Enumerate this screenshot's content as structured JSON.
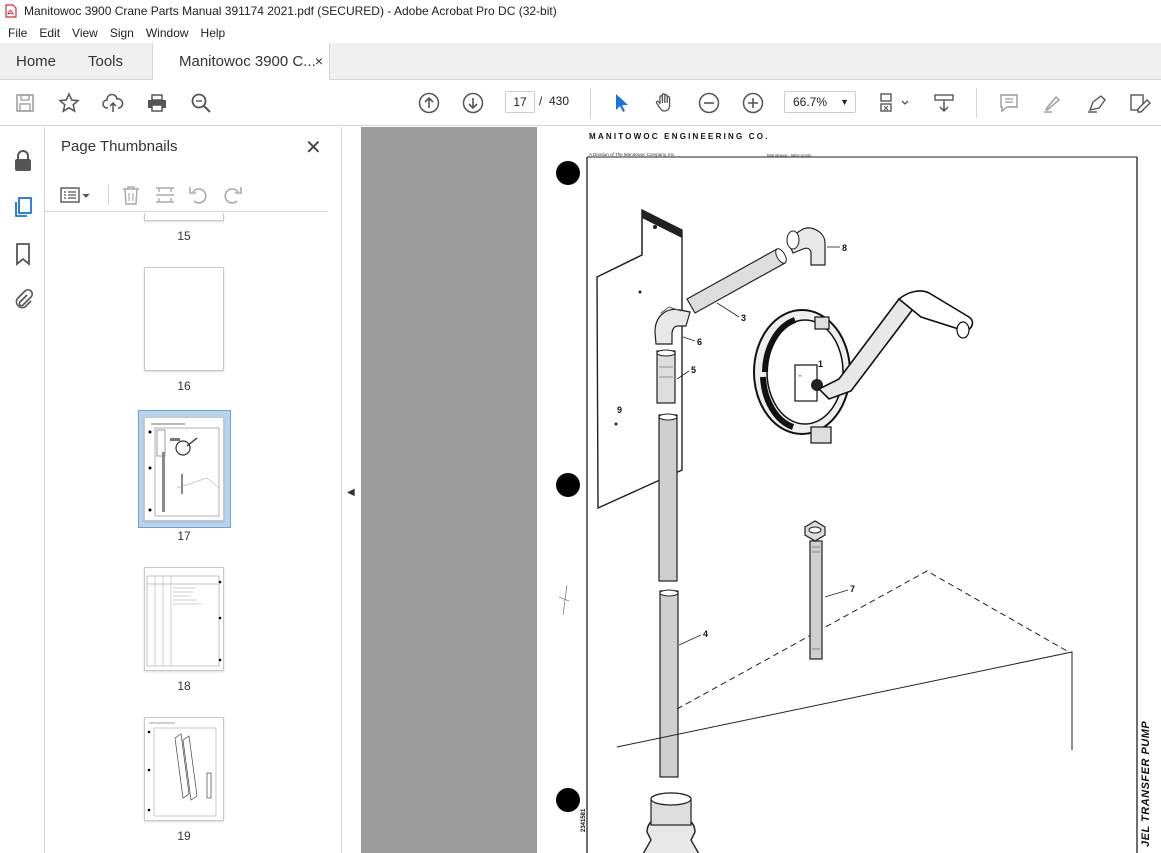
{
  "window": {
    "title": "Manitowoc 3900 Crane Parts Manual 391174 2021.pdf (SECURED) - Adobe Acrobat Pro DC (32-bit)"
  },
  "menu": [
    "File",
    "Edit",
    "View",
    "Sign",
    "Window",
    "Help"
  ],
  "tabs": {
    "home": "Home",
    "tools": "Tools",
    "doc": "Manitowoc 3900 C...",
    "doc_close": "×"
  },
  "toolbar": {
    "current_page": "17",
    "page_separator": "/",
    "total_pages": "430",
    "zoom": "66.7%",
    "icons": [
      "save-icon",
      "bookmark-star-icon",
      "upload-icon",
      "print-icon",
      "find-icon",
      "prev-page-icon",
      "next-page-icon",
      "select-cursor-icon",
      "hand-icon",
      "zoom-out-icon",
      "zoom-in-icon",
      "page-fit-icon",
      "scroll-mode-icon",
      "comment-icon",
      "highlight-icon",
      "sign-icon",
      "edit-pdf-icon"
    ]
  },
  "thumbnails_panel": {
    "title": "Page Thumbnails",
    "close": "✕",
    "pages": [
      {
        "label": "15",
        "selected": false
      },
      {
        "label": "16",
        "selected": false
      },
      {
        "label": "17",
        "selected": true
      },
      {
        "label": "18",
        "selected": false
      },
      {
        "label": "19",
        "selected": false
      }
    ]
  },
  "document_page": {
    "header": "MANITOWOC ENGINEERING CO.",
    "subheader_left": "A Division of The Manitowoc Company, Inc.",
    "subheader_right": "Manitowoc, Wisconsin",
    "side_title": "JEL TRANSFER PUMP",
    "side_number": "2341581",
    "callouts": [
      "1",
      "3",
      "4",
      "5",
      "6",
      "7",
      "8",
      "9"
    ]
  },
  "colors": {
    "accent_blue": "#1473e6",
    "selected_thumb_bg": "#b8d3ec",
    "viewer_bg": "#9c9c9c"
  }
}
